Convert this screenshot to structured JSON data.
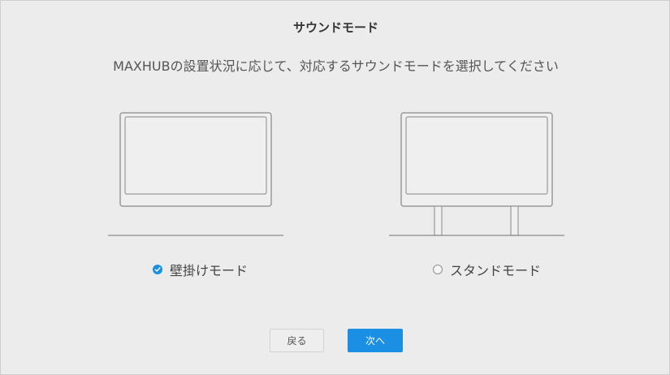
{
  "dialog": {
    "title": "サウンドモード",
    "instruction": "MAXHUBの設置状況に応じて、対応するサウンドモードを選択してください"
  },
  "options": [
    {
      "label": "壁掛けモード",
      "selected": true
    },
    {
      "label": "スタンドモード",
      "selected": false
    }
  ],
  "buttons": {
    "back_label": "戻る",
    "next_label": "次へ"
  },
  "colors": {
    "accent": "#1a8fe3",
    "background": "#ececec"
  },
  "icons": {
    "wall_illustration": "wall-mounted-display-icon",
    "stand_illustration": "stand-display-icon",
    "selected_radio": "check-circle-icon"
  }
}
